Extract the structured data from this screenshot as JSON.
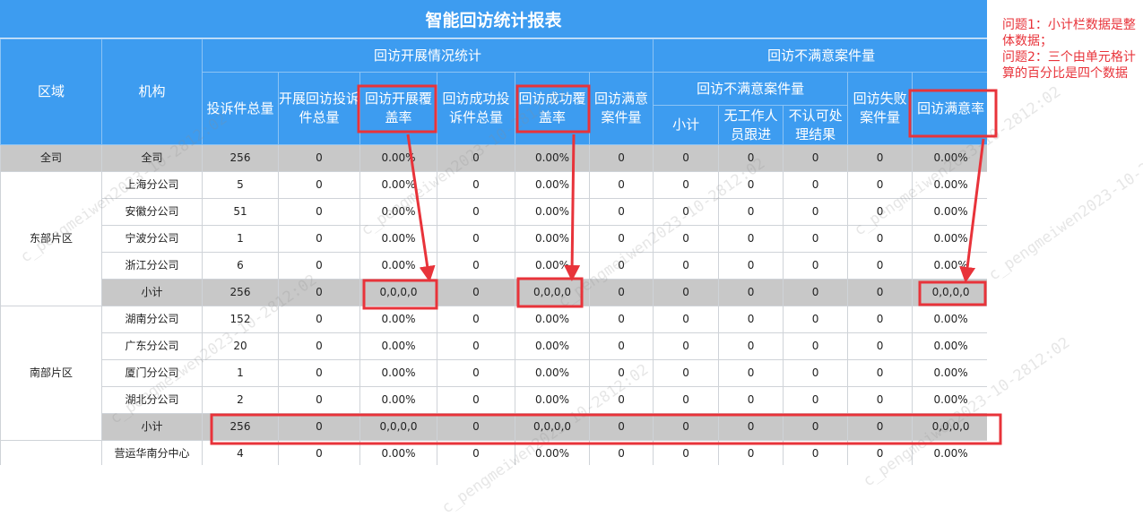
{
  "title": "智能回访统计报表",
  "headers": {
    "region": "区域",
    "org": "机构",
    "group_stats": "回访开展情况统计",
    "group_unsat": "回访不满意案件量",
    "total_complaints": "投诉件总量",
    "followup_total": "开展回访投诉件总量",
    "followup_coverage": "回访开展覆盖率",
    "success_total": "回访成功投诉件总量",
    "success_coverage": "回访成功覆盖率",
    "satisfied_count": "回访满意案件量",
    "unsat_sub": "回访不满意案件量",
    "subtotal": "小计",
    "no_followup": "无工作人员跟进",
    "not_accept": "不认可处理结果",
    "failed": "回访失败案件量",
    "satisfaction_rate": "回访满意率"
  },
  "rows": [
    {
      "region": "全司",
      "org": "全司",
      "cells": [
        "256",
        "0",
        "0.00%",
        "0",
        "0.00%",
        "0",
        "0",
        "0",
        "0",
        "0",
        "0.00%"
      ]
    },
    {
      "region": "东部片区",
      "org": "上海分公司",
      "cells": [
        "5",
        "0",
        "0.00%",
        "0",
        "0.00%",
        "0",
        "0",
        "0",
        "0",
        "0",
        "0.00%"
      ]
    },
    {
      "region": "",
      "org": "安徽分公司",
      "cells": [
        "51",
        "0",
        "0.00%",
        "0",
        "0.00%",
        "0",
        "0",
        "0",
        "0",
        "0",
        "0.00%"
      ]
    },
    {
      "region": "",
      "org": "宁波分公司",
      "cells": [
        "1",
        "0",
        "0.00%",
        "0",
        "0.00%",
        "0",
        "0",
        "0",
        "0",
        "0",
        "0.00%"
      ]
    },
    {
      "region": "",
      "org": "浙江分公司",
      "cells": [
        "6",
        "0",
        "0.00%",
        "0",
        "0.00%",
        "0",
        "0",
        "0",
        "0",
        "0",
        "0.00%"
      ]
    },
    {
      "region": "",
      "org": "小计",
      "cells": [
        "256",
        "0",
        "0,0,0,0",
        "0",
        "0,0,0,0",
        "0",
        "0",
        "0",
        "0",
        "0",
        "0,0,0,0"
      ]
    },
    {
      "region": "南部片区",
      "org": "湖南分公司",
      "cells": [
        "152",
        "0",
        "0.00%",
        "0",
        "0.00%",
        "0",
        "0",
        "0",
        "0",
        "0",
        "0.00%"
      ]
    },
    {
      "region": "",
      "org": "广东分公司",
      "cells": [
        "20",
        "0",
        "0.00%",
        "0",
        "0.00%",
        "0",
        "0",
        "0",
        "0",
        "0",
        "0.00%"
      ]
    },
    {
      "region": "",
      "org": "厦门分公司",
      "cells": [
        "1",
        "0",
        "0.00%",
        "0",
        "0.00%",
        "0",
        "0",
        "0",
        "0",
        "0",
        "0.00%"
      ]
    },
    {
      "region": "",
      "org": "湖北分公司",
      "cells": [
        "2",
        "0",
        "0.00%",
        "0",
        "0.00%",
        "0",
        "0",
        "0",
        "0",
        "0",
        "0.00%"
      ]
    },
    {
      "region": "",
      "org": "小计",
      "cells": [
        "256",
        "0",
        "0,0,0,0",
        "0",
        "0,0,0,0",
        "0",
        "0",
        "0",
        "0",
        "0",
        "0,0,0,0"
      ]
    },
    {
      "region": "",
      "org": "营运华南分中心",
      "cells": [
        "4",
        "0",
        "0.00%",
        "0",
        "0.00%",
        "0",
        "0",
        "0",
        "0",
        "0",
        "0.00%"
      ]
    }
  ],
  "notes": [
    "问题1：小计栏数据是整体数据；",
    "问题2：三个由单元格计算的百分比是四个数据"
  ],
  "watermark": "c_pengmeiwen2023-10-2812:02",
  "annotation_color": "#e8333a"
}
